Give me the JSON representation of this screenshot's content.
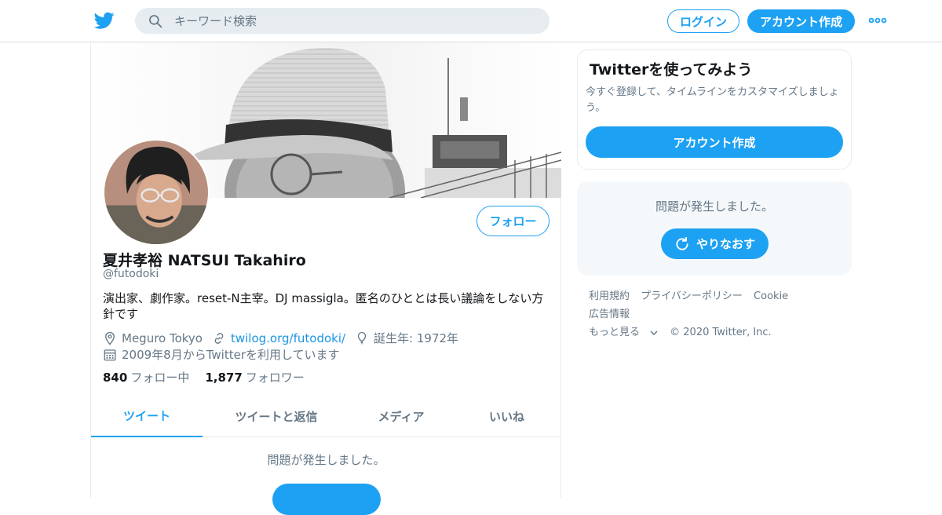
{
  "header": {
    "search_placeholder": "キーワード検索",
    "login_label": "ログイン",
    "signup_label": "アカウント作成"
  },
  "profile": {
    "name": "夏井孝裕 NATSUI Takahiro",
    "handle": "@futodoki",
    "bio": "演出家、劇作家。reset-N主宰。DJ massigla。匿名のひととは長い議論をしない方針です",
    "location": "Meguro Tokyo",
    "website": "twilog.org/futodoki/",
    "birthday": "誕生年: 1972年",
    "joined": "2009年8月からTwitterを利用しています",
    "following_count": "840",
    "following_label": "フォロー中",
    "followers_count": "1,877",
    "followers_label": "フォロワー",
    "follow_button": "フォロー"
  },
  "tabs": [
    {
      "label": "ツイート",
      "active": true
    },
    {
      "label": "ツイートと返信",
      "active": false
    },
    {
      "label": "メディア",
      "active": false
    },
    {
      "label": "いいね",
      "active": false
    }
  ],
  "main_error": "問題が発生しました。",
  "sidebar": {
    "signup_card": {
      "title": "Twitterを使ってみよう",
      "description": "今すぐ登録して、タイムラインをカスタマイズしましょう。",
      "button": "アカウント作成"
    },
    "error_card": {
      "message": "問題が発生しました。",
      "retry_label": "やりなおす"
    },
    "footer": {
      "links": [
        "利用規約",
        "プライバシーポリシー",
        "Cookie",
        "広告情報",
        "もっと見る"
      ],
      "copyright": "© 2020 Twitter, Inc."
    }
  },
  "colors": {
    "accent": "#1da1f2",
    "text_secondary": "#657786",
    "link": "#1b95e0"
  }
}
